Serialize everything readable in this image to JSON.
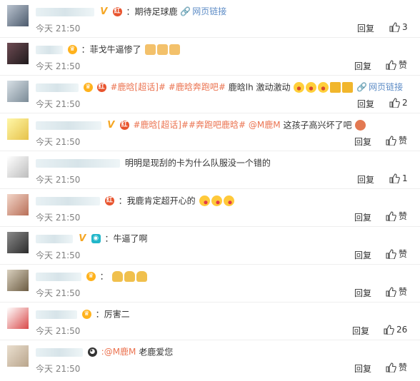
{
  "comments": [
    {
      "time": "今天 21:50",
      "reply": "回复",
      "likes": "3",
      "parts": {
        "a": "：期待足球鹿",
        "link": "网页链接"
      }
    },
    {
      "time": "今天 21:50",
      "reply": "回复",
      "likes": "赞",
      "parts": {
        "a": "：菲戈牛逼惨了"
      }
    },
    {
      "time": "今天 21:50",
      "reply": "回复",
      "likes": "2",
      "parts": {
        "tag1": "#鹿晗[超话]#",
        "tag2": "#鹿晗奔跑吧#",
        "b": " 鹿晗lh 激动激动",
        "link": "网页链接"
      }
    },
    {
      "time": "今天 21:50",
      "reply": "回复",
      "likes": "赞",
      "parts": {
        "tag1": "#鹿晗[超话]##奔跑吧鹿晗#",
        "mention": " @M鹿M",
        "b": " 这孩子高兴坏了吧"
      }
    },
    {
      "time": "今天 21:50",
      "reply": "回复",
      "likes": "1",
      "parts": {
        "a": "明明是现刮的卡为什么队服没一个错的"
      }
    },
    {
      "time": "今天 21:50",
      "reply": "回复",
      "likes": "赞",
      "parts": {
        "a": "：我鹿肯定超开心的"
      }
    },
    {
      "time": "今天 21:50",
      "reply": "回复",
      "likes": "赞",
      "parts": {
        "a": "：牛逼了啊"
      }
    },
    {
      "time": "今天 21:50",
      "reply": "回复",
      "likes": "赞",
      "parts": {
        "a": "："
      }
    },
    {
      "time": "今天 21:50",
      "reply": "回复",
      "likes": "26",
      "parts": {
        "a": "：厉害二"
      }
    },
    {
      "time": "今天 21:50",
      "reply": "回复",
      "likes": "赞",
      "parts": {
        "mention": ":@M鹿M",
        "b": " 老鹿爱您"
      }
    }
  ],
  "colors": {
    "accent": "#eb7350",
    "link": "#5d8cc6",
    "time": "#808080"
  }
}
